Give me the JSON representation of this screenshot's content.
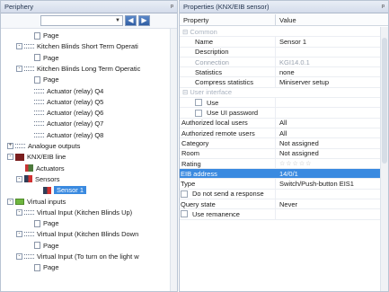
{
  "left_pane": {
    "title": "Periphery",
    "pin": "ᵖ",
    "combo_value": "",
    "tree": [
      {
        "label": "Page",
        "indent": 37,
        "icon": "page",
        "toggle": ""
      },
      {
        "label": "Kitchen Blinds Short Term Operati",
        "indent": 27,
        "icon": "wave",
        "toggle": "-"
      },
      {
        "label": "Page",
        "indent": 37,
        "icon": "page",
        "toggle": ""
      },
      {
        "label": "Kitchen Blinds Long Term Operatic",
        "indent": 27,
        "icon": "wave",
        "toggle": "-"
      },
      {
        "label": "Page",
        "indent": 37,
        "icon": "page",
        "toggle": ""
      },
      {
        "label": "Actuator (relay) Q4",
        "indent": 37,
        "icon": "wave",
        "toggle": ""
      },
      {
        "label": "Actuator (relay) Q5",
        "indent": 37,
        "icon": "wave",
        "toggle": ""
      },
      {
        "label": "Actuator (relay) Q6",
        "indent": 37,
        "icon": "wave",
        "toggle": ""
      },
      {
        "label": "Actuator (relay) Q7",
        "indent": 37,
        "icon": "wave",
        "toggle": ""
      },
      {
        "label": "Actuator (relay) Q8",
        "indent": 37,
        "icon": "wave",
        "toggle": ""
      },
      {
        "label": "Analogue outputs",
        "indent": 17,
        "icon": "wave",
        "toggle": "+"
      },
      {
        "label": "KNX/EIB line",
        "indent": 17,
        "icon": "line",
        "toggle": "-"
      },
      {
        "label": "Actuators",
        "indent": 27,
        "icon": "act",
        "toggle": ""
      },
      {
        "label": "Sensors",
        "indent": 27,
        "icon": "sensor",
        "toggle": "-"
      },
      {
        "label": "Sensor 1",
        "indent": 47,
        "icon": "sensor",
        "toggle": "",
        "selected": true
      },
      {
        "label": "Virtual inputs",
        "indent": 17,
        "icon": "vi",
        "toggle": "-"
      },
      {
        "label": "Virtual Input (Kitchen Blinds Up)",
        "indent": 27,
        "icon": "wave",
        "toggle": "-"
      },
      {
        "label": "Page",
        "indent": 37,
        "icon": "page",
        "toggle": ""
      },
      {
        "label": "Virtual Input (Kitchen Blinds Down",
        "indent": 27,
        "icon": "wave",
        "toggle": "-"
      },
      {
        "label": "Page",
        "indent": 37,
        "icon": "page",
        "toggle": ""
      },
      {
        "label": "Virtual Input (To turn on the light w",
        "indent": 27,
        "icon": "wave",
        "toggle": "-"
      },
      {
        "label": "Page",
        "indent": 37,
        "icon": "page",
        "toggle": ""
      }
    ]
  },
  "right_pane": {
    "title": "Properties (KNX/EIB sensor)",
    "pin": "ᵖ",
    "col_property": "Property",
    "col_value": "Value",
    "rows": [
      {
        "type": "cat",
        "k": "⊟  Common",
        "v": ""
      },
      {
        "type": "n",
        "k": "Name",
        "v": "Sensor 1"
      },
      {
        "type": "n",
        "k": "Description",
        "v": ""
      },
      {
        "type": "dis",
        "k": "Connection",
        "v": "KGI14.0.1"
      },
      {
        "type": "n",
        "k": "Statistics",
        "v": "none"
      },
      {
        "type": "n",
        "k": "Compress statistics",
        "v": "Miniserver setup"
      },
      {
        "type": "cat",
        "k": "⊟  User interface",
        "v": ""
      },
      {
        "type": "chk",
        "k": "Use",
        "v": ""
      },
      {
        "type": "chk",
        "k": "Use UI password",
        "v": ""
      },
      {
        "type": "flat",
        "k": "Authorized local users",
        "v": "All"
      },
      {
        "type": "flat",
        "k": "Authorized remote users",
        "v": "All"
      },
      {
        "type": "flat",
        "k": "Category",
        "v": "Not assigned"
      },
      {
        "type": "flat",
        "k": "Room",
        "v": "Not assigned"
      },
      {
        "type": "flat",
        "k": "Rating",
        "v": "☆☆☆☆☆",
        "stars": true
      },
      {
        "type": "active",
        "k": "EIB address",
        "v": "14/0/1"
      },
      {
        "type": "flat0",
        "k": "Type",
        "v": "Switch/Push-button EIS1"
      },
      {
        "type": "chk0",
        "k": "Do not send a response",
        "v": ""
      },
      {
        "type": "flat0",
        "k": "Query state",
        "v": "Never"
      },
      {
        "type": "chk0",
        "k": "Use remanence",
        "v": ""
      }
    ]
  }
}
